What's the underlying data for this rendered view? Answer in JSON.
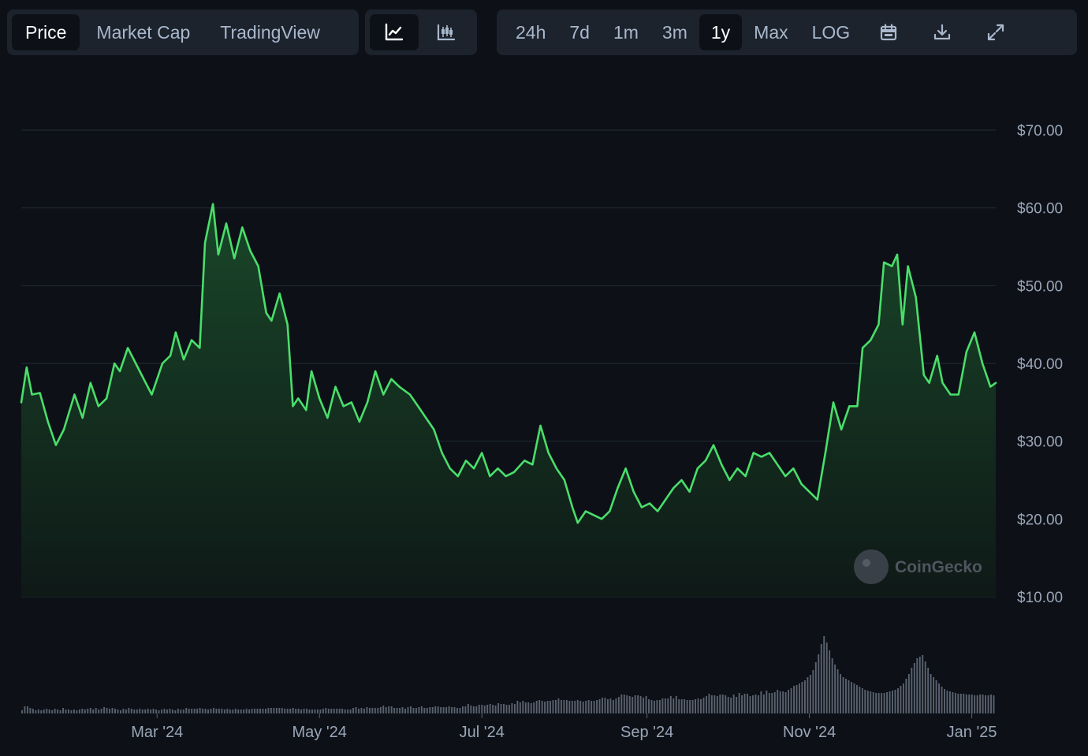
{
  "tabs": {
    "price": "Price",
    "market_cap": "Market Cap",
    "tradingview": "TradingView",
    "selected": "Price"
  },
  "chart_types": {
    "line_icon": "line-chart-icon",
    "candle_icon": "candlestick-chart-icon",
    "selected": "line"
  },
  "ranges": {
    "r24h": "24h",
    "r7d": "7d",
    "r1m": "1m",
    "r3m": "3m",
    "r1y": "1y",
    "max": "Max",
    "log": "LOG",
    "selected": "1y"
  },
  "tools": {
    "calendar_icon": "calendar-icon",
    "download_icon": "download-icon",
    "fullscreen_icon": "expand-icon"
  },
  "watermark": "CoinGecko",
  "colors": {
    "line": "#4ade6b",
    "fill_top": "#1a4a2a",
    "volume": "#5a6270",
    "grid": "#222a33",
    "background": "#0d1117"
  },
  "chart_data": {
    "type": "area",
    "title": "",
    "xlabel": "",
    "ylabel": "",
    "x_range": [
      "2024-01-10",
      "2025-01-10"
    ],
    "ylim": [
      0,
      74
    ],
    "yticks": [
      10,
      20,
      30,
      40,
      50,
      60,
      70
    ],
    "ytick_labels": [
      "$10.00",
      "$20.00",
      "$30.00",
      "$40.00",
      "$50.00",
      "$60.00",
      "$70.00"
    ],
    "xtick_labels": [
      {
        "date": "2024-03-01",
        "label": "Mar '24"
      },
      {
        "date": "2024-05-01",
        "label": "May '24"
      },
      {
        "date": "2024-07-01",
        "label": "Jul '24"
      },
      {
        "date": "2024-09-01",
        "label": "Sep '24"
      },
      {
        "date": "2024-11-01",
        "label": "Nov '24"
      },
      {
        "date": "2025-01-01",
        "label": "Jan '25"
      }
    ],
    "grid": true,
    "series": [
      {
        "values": [
          [
            "2024-01-10",
            35.0
          ],
          [
            "2024-01-12",
            39.5
          ],
          [
            "2024-01-14",
            36.0
          ],
          [
            "2024-01-17",
            36.2
          ],
          [
            "2024-01-20",
            32.5
          ],
          [
            "2024-01-23",
            29.5
          ],
          [
            "2024-01-26",
            31.5
          ],
          [
            "2024-01-30",
            36.0
          ],
          [
            "2024-02-02",
            33.0
          ],
          [
            "2024-02-05",
            37.5
          ],
          [
            "2024-02-08",
            34.5
          ],
          [
            "2024-02-11",
            35.5
          ],
          [
            "2024-02-14",
            40.0
          ],
          [
            "2024-02-16",
            39.0
          ],
          [
            "2024-02-19",
            42.0
          ],
          [
            "2024-02-22",
            40.0
          ],
          [
            "2024-02-25",
            38.0
          ],
          [
            "2024-02-28",
            36.0
          ],
          [
            "2024-03-03",
            40.0
          ],
          [
            "2024-03-06",
            41.0
          ],
          [
            "2024-03-08",
            44.0
          ],
          [
            "2024-03-11",
            40.5
          ],
          [
            "2024-03-14",
            43.0
          ],
          [
            "2024-03-17",
            42.0
          ],
          [
            "2024-03-19",
            55.5
          ],
          [
            "2024-03-22",
            60.5
          ],
          [
            "2024-03-24",
            54.0
          ],
          [
            "2024-03-27",
            58.0
          ],
          [
            "2024-03-30",
            53.5
          ],
          [
            "2024-04-02",
            57.5
          ],
          [
            "2024-04-05",
            54.5
          ],
          [
            "2024-04-08",
            52.5
          ],
          [
            "2024-04-11",
            46.5
          ],
          [
            "2024-04-13",
            45.5
          ],
          [
            "2024-04-16",
            49.0
          ],
          [
            "2024-04-19",
            45.0
          ],
          [
            "2024-04-21",
            34.5
          ],
          [
            "2024-04-23",
            35.5
          ],
          [
            "2024-04-26",
            34.0
          ],
          [
            "2024-04-28",
            39.0
          ],
          [
            "2024-05-01",
            35.5
          ],
          [
            "2024-05-04",
            33.0
          ],
          [
            "2024-05-07",
            37.0
          ],
          [
            "2024-05-10",
            34.5
          ],
          [
            "2024-05-13",
            35.0
          ],
          [
            "2024-05-16",
            32.5
          ],
          [
            "2024-05-19",
            35.0
          ],
          [
            "2024-05-22",
            39.0
          ],
          [
            "2024-05-25",
            36.0
          ],
          [
            "2024-05-28",
            38.0
          ],
          [
            "2024-05-31",
            37.0
          ],
          [
            "2024-06-04",
            36.0
          ],
          [
            "2024-06-07",
            34.5
          ],
          [
            "2024-06-10",
            33.0
          ],
          [
            "2024-06-13",
            31.5
          ],
          [
            "2024-06-16",
            28.5
          ],
          [
            "2024-06-19",
            26.5
          ],
          [
            "2024-06-22",
            25.5
          ],
          [
            "2024-06-25",
            27.5
          ],
          [
            "2024-06-28",
            26.5
          ],
          [
            "2024-07-01",
            28.5
          ],
          [
            "2024-07-04",
            25.5
          ],
          [
            "2024-07-07",
            26.5
          ],
          [
            "2024-07-10",
            25.5
          ],
          [
            "2024-07-13",
            26.0
          ],
          [
            "2024-07-17",
            27.5
          ],
          [
            "2024-07-20",
            27.0
          ],
          [
            "2024-07-23",
            32.0
          ],
          [
            "2024-07-26",
            28.5
          ],
          [
            "2024-07-29",
            26.5
          ],
          [
            "2024-08-01",
            25.0
          ],
          [
            "2024-08-04",
            21.5
          ],
          [
            "2024-08-06",
            19.5
          ],
          [
            "2024-08-09",
            21.0
          ],
          [
            "2024-08-12",
            20.5
          ],
          [
            "2024-08-15",
            20.0
          ],
          [
            "2024-08-18",
            21.0
          ],
          [
            "2024-08-21",
            24.0
          ],
          [
            "2024-08-24",
            26.5
          ],
          [
            "2024-08-27",
            23.5
          ],
          [
            "2024-08-30",
            21.5
          ],
          [
            "2024-09-02",
            22.0
          ],
          [
            "2024-09-05",
            21.0
          ],
          [
            "2024-09-08",
            22.5
          ],
          [
            "2024-09-11",
            24.0
          ],
          [
            "2024-09-14",
            25.0
          ],
          [
            "2024-09-17",
            23.5
          ],
          [
            "2024-09-20",
            26.5
          ],
          [
            "2024-09-23",
            27.5
          ],
          [
            "2024-09-26",
            29.5
          ],
          [
            "2024-09-29",
            27.0
          ],
          [
            "2024-10-02",
            25.0
          ],
          [
            "2024-10-05",
            26.5
          ],
          [
            "2024-10-08",
            25.5
          ],
          [
            "2024-10-11",
            28.5
          ],
          [
            "2024-10-14",
            28.0
          ],
          [
            "2024-10-17",
            28.5
          ],
          [
            "2024-10-20",
            27.0
          ],
          [
            "2024-10-23",
            25.5
          ],
          [
            "2024-10-26",
            26.5
          ],
          [
            "2024-10-29",
            24.5
          ],
          [
            "2024-11-01",
            23.5
          ],
          [
            "2024-11-04",
            22.5
          ],
          [
            "2024-11-07",
            28.5
          ],
          [
            "2024-11-10",
            35.0
          ],
          [
            "2024-11-13",
            31.5
          ],
          [
            "2024-11-16",
            34.5
          ],
          [
            "2024-11-19",
            34.5
          ],
          [
            "2024-11-21",
            42.0
          ],
          [
            "2024-11-24",
            43.0
          ],
          [
            "2024-11-27",
            45.0
          ],
          [
            "2024-11-29",
            53.0
          ],
          [
            "2024-12-02",
            52.5
          ],
          [
            "2024-12-04",
            54.0
          ],
          [
            "2024-12-06",
            45.0
          ],
          [
            "2024-12-08",
            52.5
          ],
          [
            "2024-12-11",
            48.5
          ],
          [
            "2024-12-14",
            38.5
          ],
          [
            "2024-12-16",
            37.5
          ],
          [
            "2024-12-19",
            41.0
          ],
          [
            "2024-12-21",
            37.5
          ],
          [
            "2024-12-24",
            36.0
          ],
          [
            "2024-12-27",
            36.0
          ],
          [
            "2024-12-30",
            41.5
          ],
          [
            "2025-01-02",
            44.0
          ],
          [
            "2025-01-05",
            40.0
          ],
          [
            "2025-01-08",
            37.0
          ],
          [
            "2025-01-10",
            37.5
          ]
        ]
      }
    ],
    "volume": [
      4,
      9,
      9,
      7,
      6,
      4,
      5,
      4,
      5,
      6,
      5,
      4,
      6,
      5,
      4,
      7,
      5,
      5,
      4,
      5,
      4,
      5,
      6,
      5,
      6,
      7,
      5,
      7,
      5,
      6,
      8,
      7,
      6,
      7,
      6,
      5,
      4,
      6,
      5,
      7,
      6,
      5,
      5,
      6,
      5,
      5,
      6,
      5,
      6,
      5,
      4,
      5,
      6,
      5,
      6,
      5,
      4,
      6,
      5,
      5,
      7,
      6,
      6,
      6,
      6,
      7,
      6,
      6,
      5,
      6,
      7,
      6,
      6,
      6,
      5,
      6,
      5,
      5,
      6,
      5,
      5,
      5,
      6,
      5,
      6,
      6,
      6,
      6,
      6,
      6,
      7,
      7,
      7,
      7,
      7,
      7,
      6,
      6,
      6,
      7,
      6,
      6,
      5,
      6,
      6,
      5,
      5,
      5,
      5,
      5,
      6,
      7,
      6,
      6,
      6,
      6,
      6,
      6,
      5,
      5,
      5,
      7,
      8,
      6,
      7,
      6,
      8,
      7,
      7,
      7,
      7,
      8,
      10,
      8,
      9,
      9,
      7,
      7,
      7,
      8,
      6,
      8,
      9,
      7,
      7,
      8,
      9,
      7,
      7,
      8,
      8,
      9,
      9,
      8,
      8,
      8,
      9,
      8,
      8,
      7,
      7,
      9,
      9,
      12,
      10,
      9,
      9,
      11,
      11,
      10,
      11,
      12,
      11,
      10,
      13,
      12,
      12,
      11,
      11,
      13,
      12,
      16,
      14,
      16,
      14,
      14,
      13,
      14,
      16,
      17,
      16,
      15,
      16,
      16,
      17,
      17,
      19,
      17,
      17,
      17,
      16,
      16,
      16,
      17,
      16,
      15,
      16,
      17,
      16,
      16,
      17,
      18,
      20,
      20,
      18,
      19,
      17,
      19,
      21,
      24,
      24,
      23,
      22,
      21,
      23,
      23,
      22,
      20,
      22,
      18,
      17,
      16,
      17,
      17,
      19,
      19,
      19,
      22,
      19,
      22,
      18,
      18,
      18,
      17,
      17,
      17,
      18,
      19,
      18,
      20,
      22,
      25,
      23,
      23,
      22,
      24,
      24,
      23,
      21,
      20,
      24,
      21,
      26,
      23,
      25,
      25,
      22,
      23,
      24,
      23,
      28,
      24,
      29,
      26,
      26,
      27,
      30,
      28,
      28,
      27,
      30,
      32,
      35,
      36,
      38,
      40,
      42,
      46,
      49,
      55,
      65,
      75,
      88,
      98,
      90,
      80,
      70,
      62,
      56,
      50,
      46,
      44,
      42,
      40,
      38,
      36,
      34,
      32,
      30,
      29,
      28,
      27,
      26,
      26,
      26,
      26,
      27,
      28,
      29,
      30,
      32,
      35,
      38,
      44,
      50,
      58,
      64,
      70,
      72,
      74,
      66,
      58,
      50,
      46,
      42,
      38,
      34,
      31,
      29,
      28,
      27,
      26,
      25,
      25,
      25,
      24,
      24,
      24,
      23,
      23,
      24,
      24,
      23,
      23,
      24,
      23
    ]
  }
}
